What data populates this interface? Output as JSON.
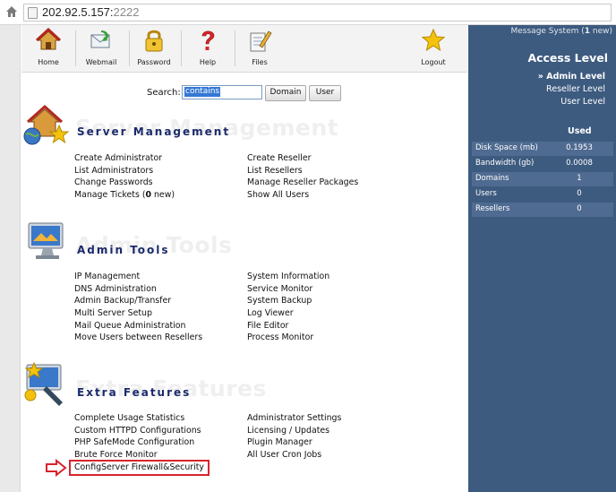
{
  "browser": {
    "url_host": "202.92.5.157:",
    "url_port": "2222"
  },
  "nav": {
    "items": [
      {
        "label": "Home",
        "icon": "home-icon"
      },
      {
        "label": "Webmail",
        "icon": "webmail-icon"
      },
      {
        "label": "Password",
        "icon": "lock-icon"
      },
      {
        "label": "Help",
        "icon": "help-icon"
      },
      {
        "label": "Files",
        "icon": "files-icon"
      },
      {
        "label": "Logout",
        "icon": "star-icon"
      }
    ]
  },
  "search": {
    "label": "Search:",
    "value": "contains",
    "domain_button": "Domain",
    "user_button": "User"
  },
  "sections": {
    "server_management": {
      "title": "Server Management",
      "watermark": "Server Management",
      "left": [
        "Create Administrator",
        "List Administrators",
        "Change Passwords"
      ],
      "tickets_prefix": "Manage Tickets (",
      "tickets_count": "0",
      "tickets_suffix": " new)",
      "right": [
        "Create Reseller",
        "List Resellers",
        "Manage Reseller Packages",
        "Show All Users"
      ]
    },
    "admin_tools": {
      "title": "Admin Tools",
      "watermark": "Admin Tools",
      "left": [
        "IP Management",
        "DNS Administration",
        "Admin Backup/Transfer",
        "Multi Server Setup",
        "Mail Queue Administration",
        "Move Users between Resellers"
      ],
      "right": [
        "System Information",
        "Service Monitor",
        "System Backup",
        "Log Viewer",
        "File Editor",
        "Process Monitor"
      ]
    },
    "extra_features": {
      "title": "Extra Features",
      "watermark": "Extra Features",
      "left": [
        "Complete Usage Statistics",
        "Custom HTTPD Configurations",
        "PHP SafeMode Configuration",
        "Brute Force Monitor",
        "ConfigServer Firewall&Security"
      ],
      "right": [
        "Administrator Settings",
        "Licensing / Updates",
        "Plugin Manager",
        "All User Cron Jobs"
      ]
    }
  },
  "sidebar": {
    "message_prefix": "Message System (",
    "message_count": "1",
    "message_suffix": " new)",
    "access_title": "Access Level",
    "levels": [
      "» Admin Level",
      "Reseller Level",
      "User Level"
    ],
    "used_header": "Used",
    "stats": [
      {
        "label": "Disk Space (mb)",
        "value": "0.1953"
      },
      {
        "label": "Bandwidth (gb)",
        "value": "0.0008"
      },
      {
        "label": "Domains",
        "value": "1"
      },
      {
        "label": "Users",
        "value": "0"
      },
      {
        "label": "Resellers",
        "value": "0"
      }
    ]
  },
  "colors": {
    "sidebar_bg": "#3d5a7f",
    "section_title": "#1b2a6b",
    "highlight": "#d8242b"
  }
}
